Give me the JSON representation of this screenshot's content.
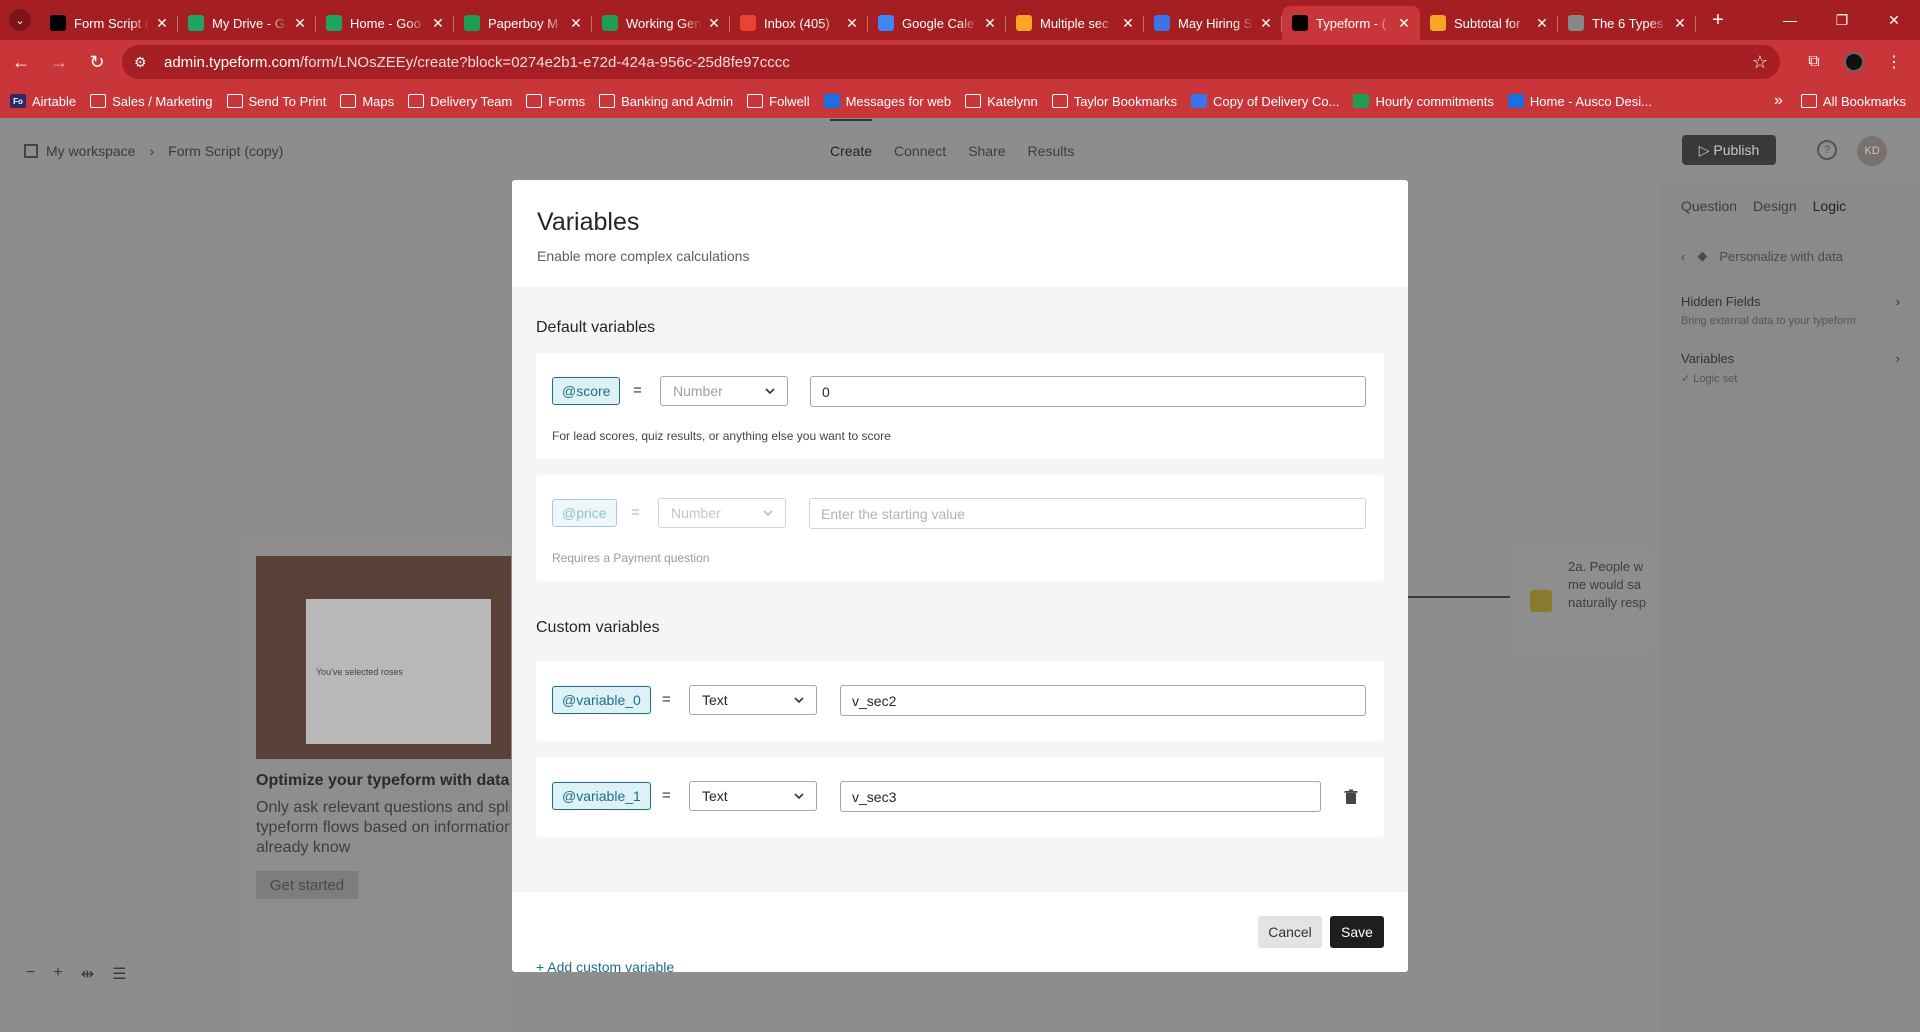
{
  "browser": {
    "tabs": [
      {
        "title": "Form Script (",
        "icon": "typeform-icon",
        "color": "#000000"
      },
      {
        "title": "My Drive - G",
        "icon": "google-drive-icon",
        "color": "#1fa463"
      },
      {
        "title": "Home - Goo",
        "icon": "google-drive-icon",
        "color": "#1fa463"
      },
      {
        "title": "Paperboy M",
        "icon": "google-sheets-icon",
        "color": "#1f9d55"
      },
      {
        "title": "Working Gen",
        "icon": "google-sheets-icon",
        "color": "#1f9d55"
      },
      {
        "title": "Inbox (405)",
        "icon": "gmail-icon",
        "color": "#ea4335"
      },
      {
        "title": "Google Cale",
        "icon": "google-calendar-icon",
        "color": "#4285f4"
      },
      {
        "title": "Multiple sec",
        "icon": "community-icon",
        "color": "#f5a623"
      },
      {
        "title": "May Hiring S",
        "icon": "google-docs-icon",
        "color": "#3b74e8"
      },
      {
        "title": "Typeform - (",
        "icon": "typeform-icon",
        "color": "#000000",
        "active": true
      },
      {
        "title": "Subtotal for",
        "icon": "community-icon",
        "color": "#f5a623"
      },
      {
        "title": "The 6 Types",
        "icon": "gear-icon",
        "color": "#888888"
      }
    ],
    "url_domain": "admin.typeform.com",
    "url_path": "/form/LNOsZEEy/create?block=0274e2b1-e72d-424a-956c-25d8fe97cccc",
    "bookmarks": [
      {
        "label": "Airtable",
        "kind": "fo"
      },
      {
        "label": "Sales / Marketing",
        "kind": "folder"
      },
      {
        "label": "Send To Print",
        "kind": "folder"
      },
      {
        "label": "Maps",
        "kind": "folder"
      },
      {
        "label": "Delivery Team",
        "kind": "folder"
      },
      {
        "label": "Forms",
        "kind": "folder"
      },
      {
        "label": "Banking and Admin",
        "kind": "folder"
      },
      {
        "label": "Folwell",
        "kind": "folder"
      },
      {
        "label": "Messages for web",
        "kind": "fill"
      },
      {
        "label": "Katelynn",
        "kind": "folder"
      },
      {
        "label": "Taylor Bookmarks",
        "kind": "folder"
      },
      {
        "label": "Copy of Delivery Co...",
        "kind": "doc"
      },
      {
        "label": "Hourly commitments",
        "kind": "green"
      },
      {
        "label": "Home - Ausco Desi...",
        "kind": "fill"
      }
    ],
    "all_bookmarks": "All Bookmarks"
  },
  "app": {
    "breadcrumb_workspace": "My workspace",
    "breadcrumb_form": "Form Script (copy)",
    "nav": [
      "Create",
      "Connect",
      "Share",
      "Results"
    ],
    "publish": "Publish",
    "avatar": "KD",
    "right_tabs": [
      "Question",
      "Design",
      "Logic"
    ],
    "right_title": "Personalize with data",
    "hidden_fields": "Hidden Fields",
    "hidden_fields_sub": "Bring external data to your typeform",
    "variables": "Variables",
    "variables_sub": "Logic set",
    "promo_title": "Optimize your typeform with data",
    "promo_text_1": "Only ask relevant questions and split",
    "promo_text_2": "typeform flows based on information",
    "promo_text_3": "already know",
    "promo_button": "Get started",
    "promo_screen_label": "You've selected roses",
    "node_line_1": "2a. People w",
    "node_line_2": "me would sa",
    "node_line_3": "naturally resp"
  },
  "modal": {
    "title": "Variables",
    "subtitle": "Enable more complex calculations",
    "default_section": "Default variables",
    "custom_section": "Custom variables",
    "score": {
      "name": "@score",
      "eq": "=",
      "type_placeholder": "Number",
      "value": "0",
      "hint": "For lead scores, quiz results, or anything else you want to score"
    },
    "price": {
      "name": "@price",
      "eq": "=",
      "type_placeholder": "Number",
      "value_placeholder": "Enter the starting value",
      "hint": "Requires a Payment question"
    },
    "custom": [
      {
        "name": "@variable_0",
        "eq": "=",
        "type": "Text",
        "value": "v_sec2"
      },
      {
        "name": "@variable_1",
        "eq": "=",
        "type": "Text",
        "value": "v_sec3"
      }
    ],
    "add_custom": "+ Add custom variable",
    "cancel": "Cancel",
    "save": "Save"
  }
}
